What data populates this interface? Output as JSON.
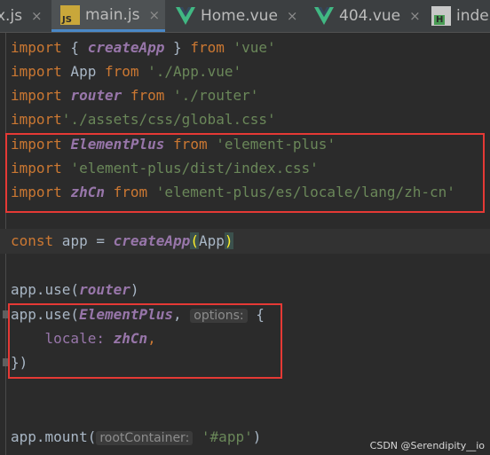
{
  "tabs": [
    {
      "label": "x.js",
      "icon": "js-file-icon"
    },
    {
      "label": "main.js",
      "icon": "js-file-icon",
      "active": true
    },
    {
      "label": "Home.vue",
      "icon": "vue-file-icon"
    },
    {
      "label": "404.vue",
      "icon": "vue-file-icon"
    },
    {
      "label": "inde",
      "icon": "html-file-icon"
    }
  ],
  "js_badge": "JS",
  "html_badge": "H",
  "close_glyph": "×",
  "code": {
    "l1": {
      "kw": "import",
      "open": " { ",
      "name": "createApp",
      "close": " } ",
      "from": "from",
      "src": " 'vue'"
    },
    "l2": {
      "kw": "import",
      "name": " App ",
      "from": "from",
      "src": " './App.vue'"
    },
    "l3": {
      "kw": "import",
      "name": "router",
      "from": "from",
      "src": " './router'"
    },
    "l4": {
      "kw": "import",
      "src": "'./assets/css/global.css'"
    },
    "l5": {
      "kw": "import",
      "name": "ElementPlus",
      "from": "from",
      "src": " 'element-plus'"
    },
    "l6": {
      "kw": "import",
      "src": " 'element-plus/dist/index.css'"
    },
    "l7": {
      "kw": "import",
      "name": "zhCn",
      "from": "from",
      "src": " 'element-plus/es/locale/lang/zh-cn'"
    },
    "l8": {
      "kw": "const",
      "var": " app = ",
      "fn": "createApp",
      "open": "(",
      "arg": "App",
      "close": ")"
    },
    "l9": {
      "obj": "app.use(",
      "arg": "router",
      "close": ")"
    },
    "l10": {
      "obj": "app.use(",
      "arg": "ElementPlus",
      "comma": ", ",
      "hint": "options:",
      "brace": " {"
    },
    "l11": {
      "indent": "    ",
      "key": "locale: ",
      "val": "zhCn",
      "comma": ","
    },
    "l12": {
      "text": "})"
    },
    "l13": {
      "obj": "app.mount(",
      "hint": "rootContainer:",
      "src": " '#app'",
      "close": ")"
    }
  },
  "watermark": "CSDN @Serendipity__io",
  "colors": {
    "keyword": "#cc7832",
    "string": "#6a8759",
    "identifier": "#9876aa",
    "annotation_box": "#e53935"
  }
}
